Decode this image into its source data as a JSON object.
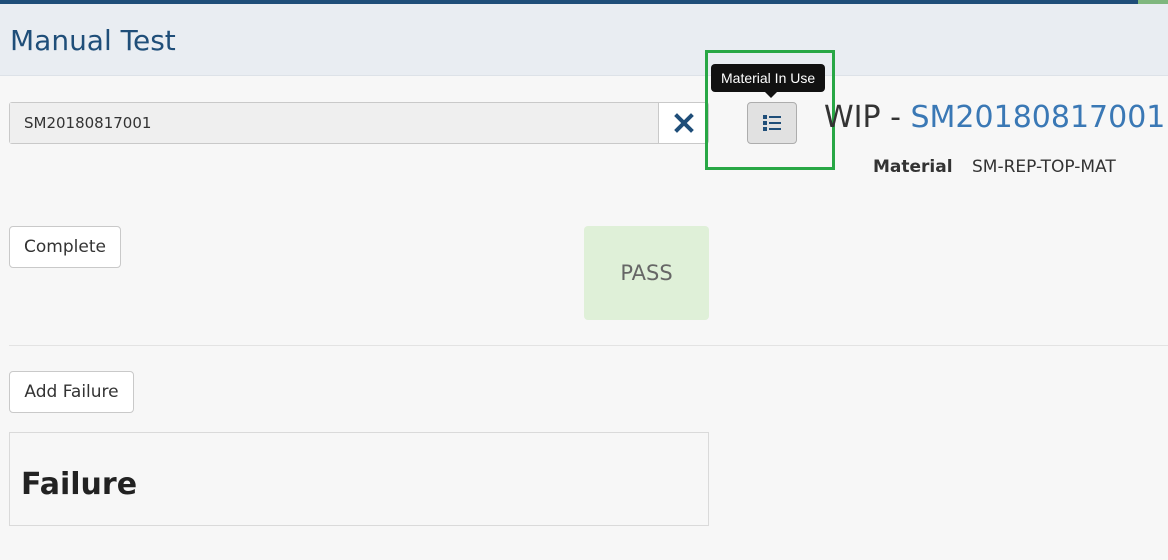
{
  "colors": {
    "header_bg": "#e9edf2",
    "title": "#1f4e79",
    "link": "#3a78b5",
    "pass_bg": "#dff0d8",
    "highlight": "#28a745"
  },
  "header": {
    "title": "Manual Test"
  },
  "search": {
    "value": "SM20180817001",
    "clear_icon": "close-icon"
  },
  "tooltip": {
    "text": "Material In Use"
  },
  "list_button": {
    "icon": "list-icon"
  },
  "wip": {
    "prefix": "WIP - ",
    "id": "SM20180817001"
  },
  "material": {
    "label": "Material",
    "value": "SM-REP-TOP-MAT"
  },
  "actions": {
    "complete_label": "Complete",
    "add_failure_label": "Add Failure"
  },
  "status": {
    "result": "PASS"
  },
  "failure": {
    "heading": "Failure"
  }
}
